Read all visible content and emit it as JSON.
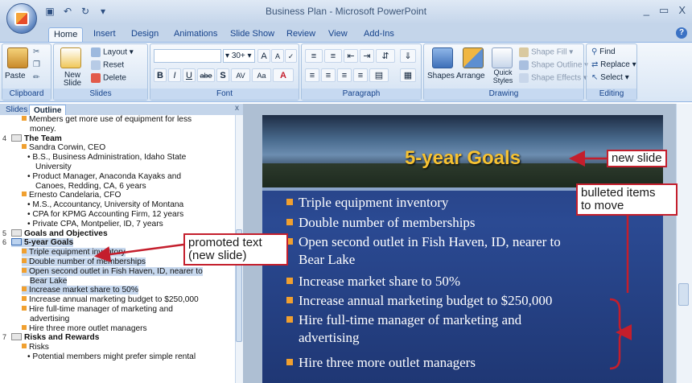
{
  "window": {
    "title": "Business Plan - Microsoft PowerPoint",
    "controls": [
      "_",
      "▭",
      "X"
    ]
  },
  "tabs": [
    "Home",
    "Insert",
    "Design",
    "Animations",
    "Slide Show",
    "Review",
    "View",
    "Add-Ins"
  ],
  "ribbon": {
    "clipboard": {
      "label": "Clipboard",
      "paste": "Paste"
    },
    "slides": {
      "label": "Slides",
      "new_slide": "New Slide",
      "layout": "Layout",
      "reset": "Reset",
      "delete": "Delete"
    },
    "font": {
      "label": "Font",
      "size": "30+",
      "buttons": [
        "B",
        "I",
        "U",
        "abe",
        "S",
        "AV",
        "Aa",
        "A"
      ]
    },
    "paragraph": {
      "label": "Paragraph"
    },
    "drawing": {
      "label": "Drawing",
      "shapes": "Shapes",
      "arrange": "Arrange",
      "quick_styles": "Quick Styles",
      "shape_fill": "Shape Fill",
      "shape_outline": "Shape Outline",
      "shape_effects": "Shape Effects"
    },
    "editing": {
      "label": "Editing",
      "find": "Find",
      "replace": "Replace",
      "select": "Select"
    }
  },
  "panel": {
    "tab_slides": "Slides",
    "tab_outline": "Outline",
    "close": "x"
  },
  "outline": [
    {
      "text": "Members get more use of equipment for less",
      "level": 1
    },
    {
      "text": "money.",
      "level": 1,
      "cont": true
    },
    {
      "num": "4",
      "text": "The Team",
      "level": 0
    },
    {
      "text": "Sandra Corwin, CEO",
      "level": 1
    },
    {
      "text": "• B.S., Business Administration, Idaho State",
      "level": 2
    },
    {
      "text": "University",
      "level": 2,
      "cont": true
    },
    {
      "text": "• Product Manager, Anaconda Kayaks and",
      "level": 2
    },
    {
      "text": "Canoes, Redding, CA, 6 years",
      "level": 2,
      "cont": true
    },
    {
      "text": "Ernesto Candelaria, CFO",
      "level": 1
    },
    {
      "text": "• M.S., Accountancy, University of Montana",
      "level": 2
    },
    {
      "text": "• CPA for KPMG Accounting Firm, 12 years",
      "level": 2
    },
    {
      "text": "• Private CPA, Montpelier, ID, 7 years",
      "level": 2
    },
    {
      "num": "5",
      "text": "Goals and Objectives",
      "level": 0
    },
    {
      "num": "6",
      "text": "5-year Goals",
      "level": 0,
      "sel": true
    },
    {
      "text": "Triple equipment inventory",
      "level": 1,
      "sel": true
    },
    {
      "text": "Double number of memberships",
      "level": 1,
      "sel": true
    },
    {
      "text": "Open second outlet in Fish Haven, ID, nearer to",
      "level": 1,
      "sel": true
    },
    {
      "text": "Bear Lake",
      "level": 1,
      "cont": true,
      "sel": true
    },
    {
      "text": "Increase market share to 50%",
      "level": 1,
      "sel": true
    },
    {
      "text": "Increase annual marketing budget to $250,000",
      "level": 1
    },
    {
      "text": "Hire full-time manager of marketing and",
      "level": 1
    },
    {
      "text": "advertising",
      "level": 1,
      "cont": true
    },
    {
      "text": "Hire three more outlet managers",
      "level": 1
    },
    {
      "num": "7",
      "text": "Risks and Rewards",
      "level": 0
    },
    {
      "text": "Risks",
      "level": 1
    },
    {
      "text": "• Potential members might prefer simple rental",
      "level": 2
    }
  ],
  "slide": {
    "title": "5-year Goals",
    "bullets": [
      "Triple equipment inventory",
      "Double number of memberships",
      "Open second outlet in Fish Haven, ID, nearer to",
      "Bear Lake",
      "Increase market share to 50%",
      "Increase annual marketing budget to $250,000",
      "Hire full-time manager of marketing and",
      "advertising",
      "Hire three more outlet managers"
    ]
  },
  "callouts": {
    "new_slide": "new slide",
    "bulleted_1": "bulleted items",
    "bulleted_2": "to move",
    "promoted_1": "promoted text",
    "promoted_2": "(new slide)"
  }
}
